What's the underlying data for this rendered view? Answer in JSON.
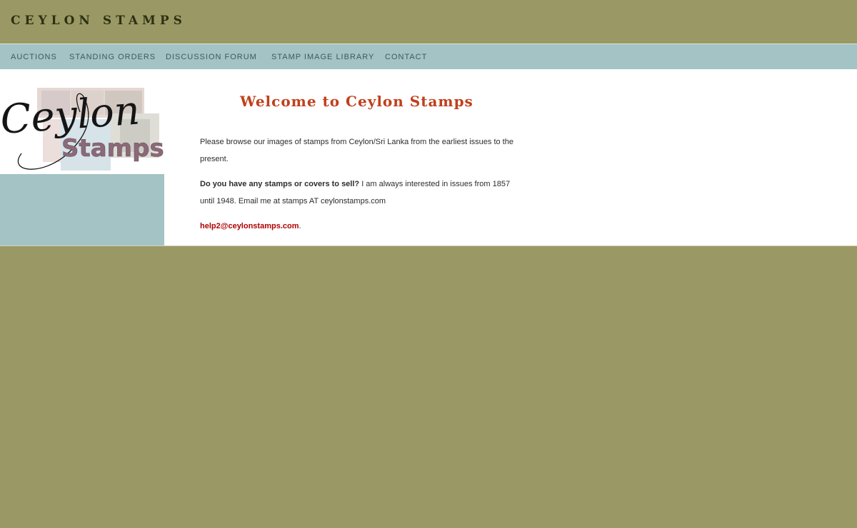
{
  "header": {
    "title": "CEYLON STAMPS"
  },
  "nav": {
    "items": [
      {
        "label": "AUCTIONS"
      },
      {
        "label": "STANDING ORDERS"
      },
      {
        "label": "DISCUSSION FORUM"
      },
      {
        "label": "STAMP IMAGE LIBRARY"
      },
      {
        "label": "CONTACT"
      }
    ]
  },
  "logo": {
    "script_text": "Ceylon",
    "word": "Stamps"
  },
  "main": {
    "heading": "Welcome to Ceylon Stamps",
    "intro": "Please browse our images of stamps from Ceylon/Sri Lanka from the earliest issues to the present.",
    "sell_question": "Do you have any stamps or covers to sell?",
    "sell_text": " I am always interested in issues from 1857 until 1948. Email me at stamps AT ceylonstamps.com",
    "email": "help2@ceylonstamps.com",
    "email_suffix": "."
  },
  "colors": {
    "background": "#9a9965",
    "nav": "#a3c3c4",
    "heading": "#c0401c",
    "link": "#b00000"
  }
}
